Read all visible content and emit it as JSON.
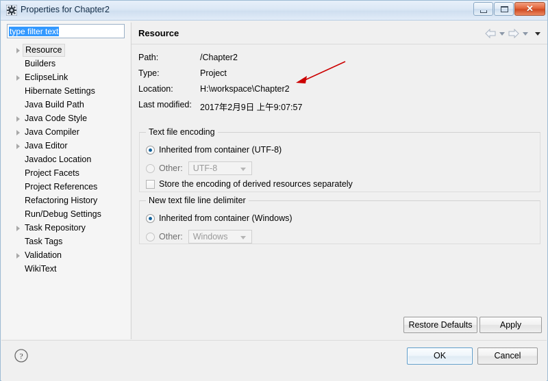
{
  "window": {
    "title": "Properties for Chapter2",
    "title_icon": "gear-icon",
    "minimize_label": "",
    "maximize_label": "",
    "close_label": "✕"
  },
  "sidebar": {
    "filter": {
      "value": "type filter text",
      "placeholder": "type filter text",
      "selected": true
    },
    "items": [
      {
        "label": "Resource",
        "expandable": true,
        "selected": true
      },
      {
        "label": "Builders",
        "expandable": false,
        "selected": false
      },
      {
        "label": "EclipseLink",
        "expandable": true,
        "selected": false
      },
      {
        "label": "Hibernate Settings",
        "expandable": false,
        "selected": false
      },
      {
        "label": "Java Build Path",
        "expandable": false,
        "selected": false
      },
      {
        "label": "Java Code Style",
        "expandable": true,
        "selected": false
      },
      {
        "label": "Java Compiler",
        "expandable": true,
        "selected": false
      },
      {
        "label": "Java Editor",
        "expandable": true,
        "selected": false
      },
      {
        "label": "Javadoc Location",
        "expandable": false,
        "selected": false
      },
      {
        "label": "Project Facets",
        "expandable": false,
        "selected": false
      },
      {
        "label": "Project References",
        "expandable": false,
        "selected": false
      },
      {
        "label": "Refactoring History",
        "expandable": false,
        "selected": false
      },
      {
        "label": "Run/Debug Settings",
        "expandable": false,
        "selected": false
      },
      {
        "label": "Task Repository",
        "expandable": true,
        "selected": false
      },
      {
        "label": "Task Tags",
        "expandable": false,
        "selected": false
      },
      {
        "label": "Validation",
        "expandable": true,
        "selected": false
      },
      {
        "label": "WikiText",
        "expandable": false,
        "selected": false
      }
    ]
  },
  "main": {
    "page_title": "Resource",
    "nav": {
      "back_icon": "back-arrow-icon",
      "back_dropdown_icon": "chevron-down-icon",
      "forward_icon": "forward-arrow-icon",
      "forward_dropdown_icon": "chevron-down-icon",
      "menu_icon": "chevron-down-icon"
    },
    "info": [
      {
        "label": "Path:",
        "value": "/Chapter2"
      },
      {
        "label": "Type:",
        "value": "Project"
      },
      {
        "label": "Location:",
        "value": "H:\\workspace\\Chapter2"
      },
      {
        "label": "Last modified:",
        "value": "2017年2月9日 上午9:07:57"
      }
    ],
    "encoding_group": {
      "title": "Text file encoding",
      "inherited_label": "Inherited from container (UTF-8)",
      "inherited_selected": true,
      "other_label": "Other:",
      "other_selected": false,
      "other_enabled": false,
      "other_value": "UTF-8",
      "store_derived_label": "Store the encoding of derived resources separately",
      "store_derived_checked": false
    },
    "delimiter_group": {
      "title": "New text file line delimiter",
      "inherited_label": "Inherited from container (Windows)",
      "inherited_selected": true,
      "other_label": "Other:",
      "other_selected": false,
      "other_enabled": false,
      "other_value": "Windows"
    },
    "restore_defaults_label": "Restore Defaults",
    "apply_label": "Apply"
  },
  "bottom": {
    "help_icon": "help-question-icon",
    "ok_label": "OK",
    "cancel_label": "Cancel"
  },
  "annotation": {
    "type": "arrow",
    "color": "#cc0000",
    "points_at": "Location value"
  },
  "colors": {
    "accent": "#3399ff",
    "radio_dot": "#15639c",
    "annotation": "#cc0000",
    "titlebar": "#dbe7f5",
    "panel_bg": "#f0f0f0"
  }
}
